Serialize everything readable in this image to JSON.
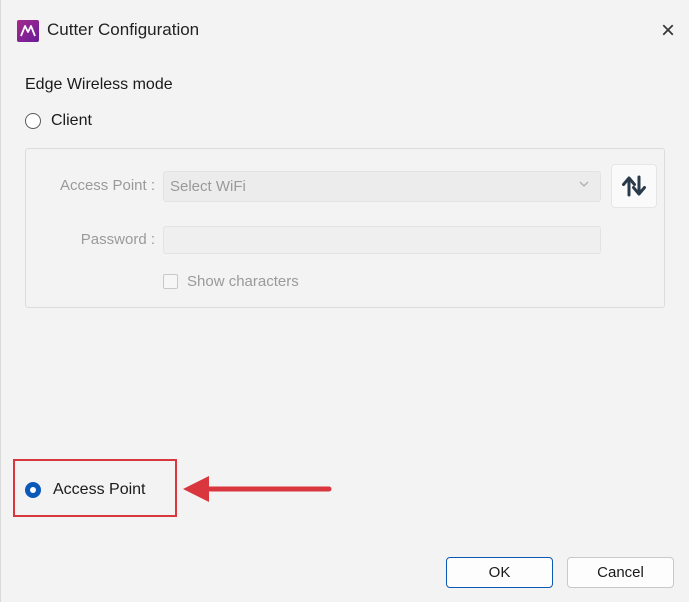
{
  "window": {
    "title": "Cutter Configuration",
    "close_symbol": "×",
    "app_icon": "app-logo-icon"
  },
  "edge_wireless_mode": {
    "label": "Edge Wireless mode",
    "client_option": {
      "label": "Client",
      "selected": false
    },
    "access_point_option": {
      "label": "Access Point",
      "selected": true
    }
  },
  "client_settings": {
    "access_point_label": "Access Point :",
    "access_point_value": "Select WiFi",
    "refresh_icon": "refresh-arrows-icon",
    "password_label": "Password :",
    "password_value": "",
    "show_characters_label": "Show characters",
    "show_characters_checked": false,
    "disabled": true
  },
  "annotation": {
    "highlight_color": "#d9363e",
    "arrow_icon": "red-arrow-left-icon"
  },
  "buttons": {
    "ok_label": "OK",
    "cancel_label": "Cancel"
  },
  "colors": {
    "accent": "#0a58b8",
    "dialog_bg": "#f3f3f3",
    "disabled_text": "#9a9a9a"
  }
}
